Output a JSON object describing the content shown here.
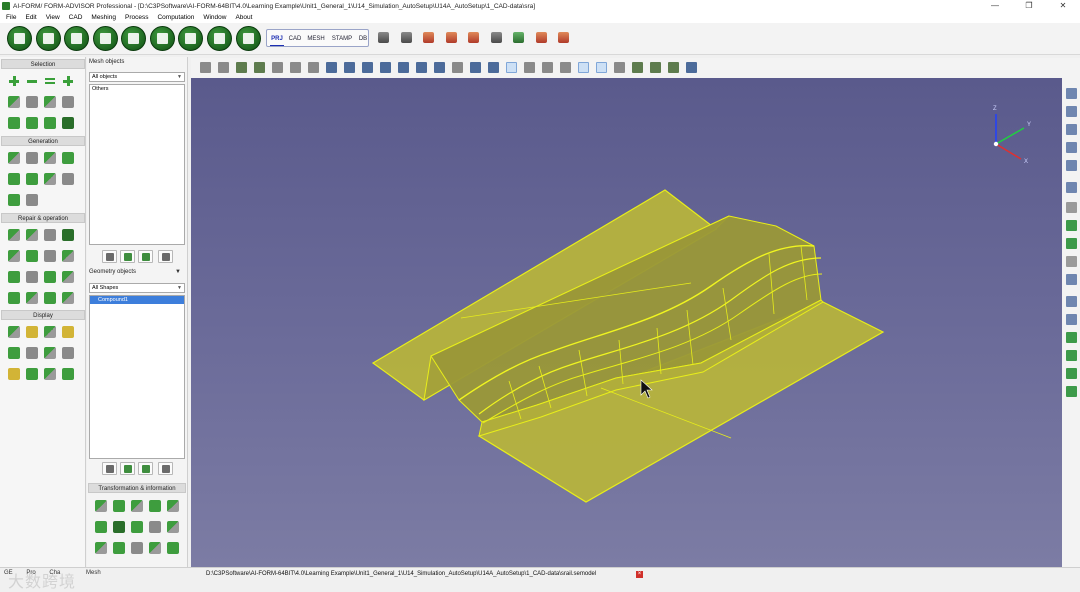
{
  "window": {
    "title": "AI-FORM/ FORM-ADVISOR Professional - [D:\\C3PSoftware\\AI-FORM-64BIT\\4.0\\Learning Example\\Unit1_General_1\\U14_Simulation_AutoSetup\\U14A_AutoSetup\\1_CAD-data\\sra]",
    "minimize": "—",
    "maximize": "❐",
    "close": "✕"
  },
  "menu": [
    "File",
    "Edit",
    "View",
    "CAD",
    "Meshing",
    "Process",
    "Computation",
    "Window",
    "About"
  ],
  "mode_tabs": [
    "PRJ",
    "CAD",
    "MESH",
    "STAMP",
    "DB"
  ],
  "active_mode": "PRJ",
  "left_panel": {
    "sections": [
      "Selection",
      "Generation",
      "Repair & operation",
      "Display"
    ]
  },
  "mid_panel": {
    "mesh_objects_label": "Mesh objects",
    "mesh_filter": "All objects",
    "mesh_list": [
      "Others"
    ],
    "geometry_objects_label": "Geometry objects",
    "geometry_filter": "All Shapes",
    "geometry_list": [
      "Compound1"
    ],
    "transform_label": "Transformation & information"
  },
  "axis": {
    "x": "X",
    "y": "Y",
    "z": "Z"
  },
  "colors": {
    "part_fill": "#b9b53a",
    "part_edge": "#e8ee1a",
    "accent": "#2a7d2a"
  },
  "status": {
    "tabs": [
      "GE",
      "Pro",
      "Cha",
      "",
      "Mesh"
    ],
    "path": "D:\\C3PSoftware\\AI-FORM-64BIT\\4.0\\Learning Example\\Unit1_General_1\\U14_Simulation_AutoSetup\\U14A_AutoSetup\\1_CAD-data\\srail.semodel",
    "close_glyph": "×",
    "watermark": "大数跨境"
  }
}
